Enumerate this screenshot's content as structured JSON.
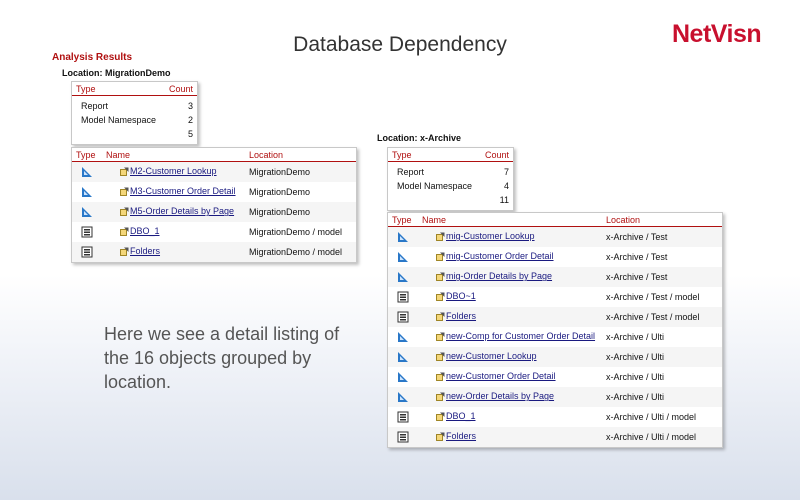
{
  "slide": {
    "title": "Database Dependency",
    "logo": "NetVisn",
    "caption": "Here we see a detail listing of the 16 objects grouped by location."
  },
  "report": {
    "heading": "Analysis Results",
    "locations": [
      {
        "label": "Location: MigrationDemo",
        "summary": {
          "headers": {
            "type": "Type",
            "count": "Count"
          },
          "rows": [
            {
              "type": "Report",
              "count": "3"
            },
            {
              "type": "Model Namespace",
              "count": "2"
            }
          ],
          "total": "5"
        },
        "detail": {
          "headers": {
            "type": "Type",
            "name": "Name",
            "location": "Location"
          },
          "rows": [
            {
              "icon": "report-icon",
              "name": "M2-Customer Lookup",
              "location": "MigrationDemo"
            },
            {
              "icon": "report-icon",
              "name": "M3-Customer Order Detail",
              "location": "MigrationDemo"
            },
            {
              "icon": "report-icon",
              "name": "M5-Order Details by Page",
              "location": "MigrationDemo"
            },
            {
              "icon": "namespace-icon",
              "name": "DBO_1",
              "location": "MigrationDemo / model"
            },
            {
              "icon": "namespace-icon",
              "name": "Folders",
              "location": "MigrationDemo / model"
            }
          ]
        }
      },
      {
        "label": "Location: x-Archive",
        "summary": {
          "headers": {
            "type": "Type",
            "count": "Count"
          },
          "rows": [
            {
              "type": "Report",
              "count": "7"
            },
            {
              "type": "Model Namespace",
              "count": "4"
            }
          ],
          "total": "11"
        },
        "detail": {
          "headers": {
            "type": "Type",
            "name": "Name",
            "location": "Location"
          },
          "rows": [
            {
              "icon": "report-icon",
              "name": "mig-Customer Lookup",
              "location": "x-Archive / Test"
            },
            {
              "icon": "report-icon",
              "name": "mig-Customer Order Detail",
              "location": "x-Archive / Test"
            },
            {
              "icon": "report-icon",
              "name": "mig-Order Details by Page",
              "location": "x-Archive / Test"
            },
            {
              "icon": "namespace-icon",
              "name": "DBO~1",
              "location": "x-Archive / Test / model"
            },
            {
              "icon": "namespace-icon",
              "name": "Folders",
              "location": "x-Archive / Test / model"
            },
            {
              "icon": "report-icon",
              "name": "new-Comp for Customer Order Detail",
              "location": "x-Archive / Ulti"
            },
            {
              "icon": "report-icon",
              "name": "new-Customer Lookup",
              "location": "x-Archive / Ulti"
            },
            {
              "icon": "report-icon",
              "name": "new-Customer Order Detail",
              "location": "x-Archive / Ulti"
            },
            {
              "icon": "report-icon",
              "name": "new-Order Details by Page",
              "location": "x-Archive / Ulti"
            },
            {
              "icon": "namespace-icon",
              "name": "DBO_1",
              "location": "x-Archive / Ulti / model"
            },
            {
              "icon": "namespace-icon",
              "name": "Folders",
              "location": "x-Archive / Ulti / model"
            }
          ]
        }
      }
    ]
  },
  "colors": {
    "accent": "#b01010",
    "link": "#1a1a80",
    "logo": "#c8102e",
    "report_icon": "#2a78c8"
  }
}
